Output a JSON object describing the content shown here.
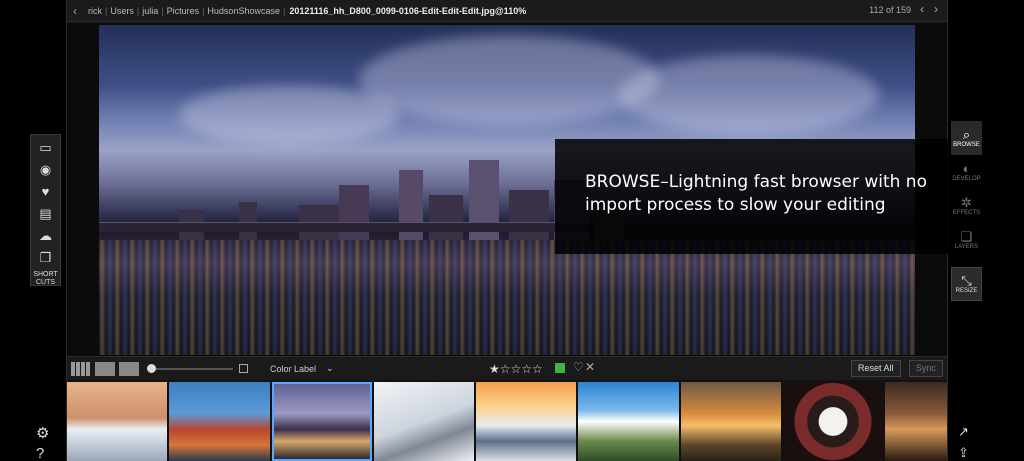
{
  "titlebar": {
    "crumbs": [
      "rick",
      "Users",
      "julia",
      "Pictures",
      "HudsonShowcase"
    ],
    "filename": "20121116_hh_D800_0099-0106-Edit-Edit-Edit.jpg@110%",
    "counter": "112 of 159"
  },
  "overlay": {
    "text": "BROWSE–Lightning fast browser with no import process to slow your editing"
  },
  "toolbar": {
    "color_label": "Color Label",
    "rating_stars": "★☆☆☆☆",
    "reset_label": "Reset All",
    "sync_label": "Sync"
  },
  "shortcuts": {
    "label": "SHORT CUTS",
    "icons": [
      "computer-icon",
      "camera-icon",
      "favorites-icon",
      "drive-icon",
      "cloud-icon",
      "albums-icon"
    ]
  },
  "modules": [
    {
      "label": "BROWSE",
      "icon": "browse-icon"
    },
    {
      "label": "DEVELOP",
      "icon": "develop-icon"
    },
    {
      "label": "EFFECTS",
      "icon": "effects-icon"
    },
    {
      "label": "LAYERS",
      "icon": "layers-icon"
    }
  ],
  "resize_label": "RESIZE",
  "colors": {
    "accent": "#5aa7ff",
    "green_label": "#39b54a"
  },
  "thumbnails": [
    {
      "name": "mountain-sunset",
      "bg": "linear-gradient(180deg,#e7b58b,#cf8f6c 45%,#e9eef4 60%,#9aa7b8)"
    },
    {
      "name": "golden-gate",
      "bg": "linear-gradient(180deg,#3d7ec2,#5c9bd6 40%,#b9462f 60%,#d6753b 80%,#2b3a4f)"
    },
    {
      "name": "city-night",
      "bg": "linear-gradient(180deg,#5a5f92,#9c9ac1 40%,#3a2e4a 60%,#d7a869 75%,#1c1a28)"
    },
    {
      "name": "skier",
      "bg": "linear-gradient(160deg,#f2f3f6,#cdd4de 50%,#7f8896 70%,#eef0f3)"
    },
    {
      "name": "snow-valley",
      "bg": "linear-gradient(180deg,#f3a14a,#fbd18a 30%,#e7ebf0 55%,#5b6f8a 75%,#d9dee5)"
    },
    {
      "name": "coast-clouds",
      "bg": "linear-gradient(180deg,#2c84d3,#78b7ea 35%,#ffffff 50%,#6a8a4a 75%,#2f4b2a)"
    },
    {
      "name": "sunset-field",
      "bg": "linear-gradient(180deg,#6e5a47,#d88a3d 40%,#f6c06a 55%,#5a4428 80%,#2a2218)"
    },
    {
      "name": "skull-face",
      "bg": "radial-gradient(circle at 50% 50%,#f4f2ee 0 22%,#2a1b1b 23% 40%,#7a2b2b 41% 60%,#1a0f0f 61%)"
    },
    {
      "name": "market-night",
      "bg": "linear-gradient(180deg,#3a2a22,#8b5a3a 40%,#d89a5a 60%,#2a1a14)"
    }
  ]
}
